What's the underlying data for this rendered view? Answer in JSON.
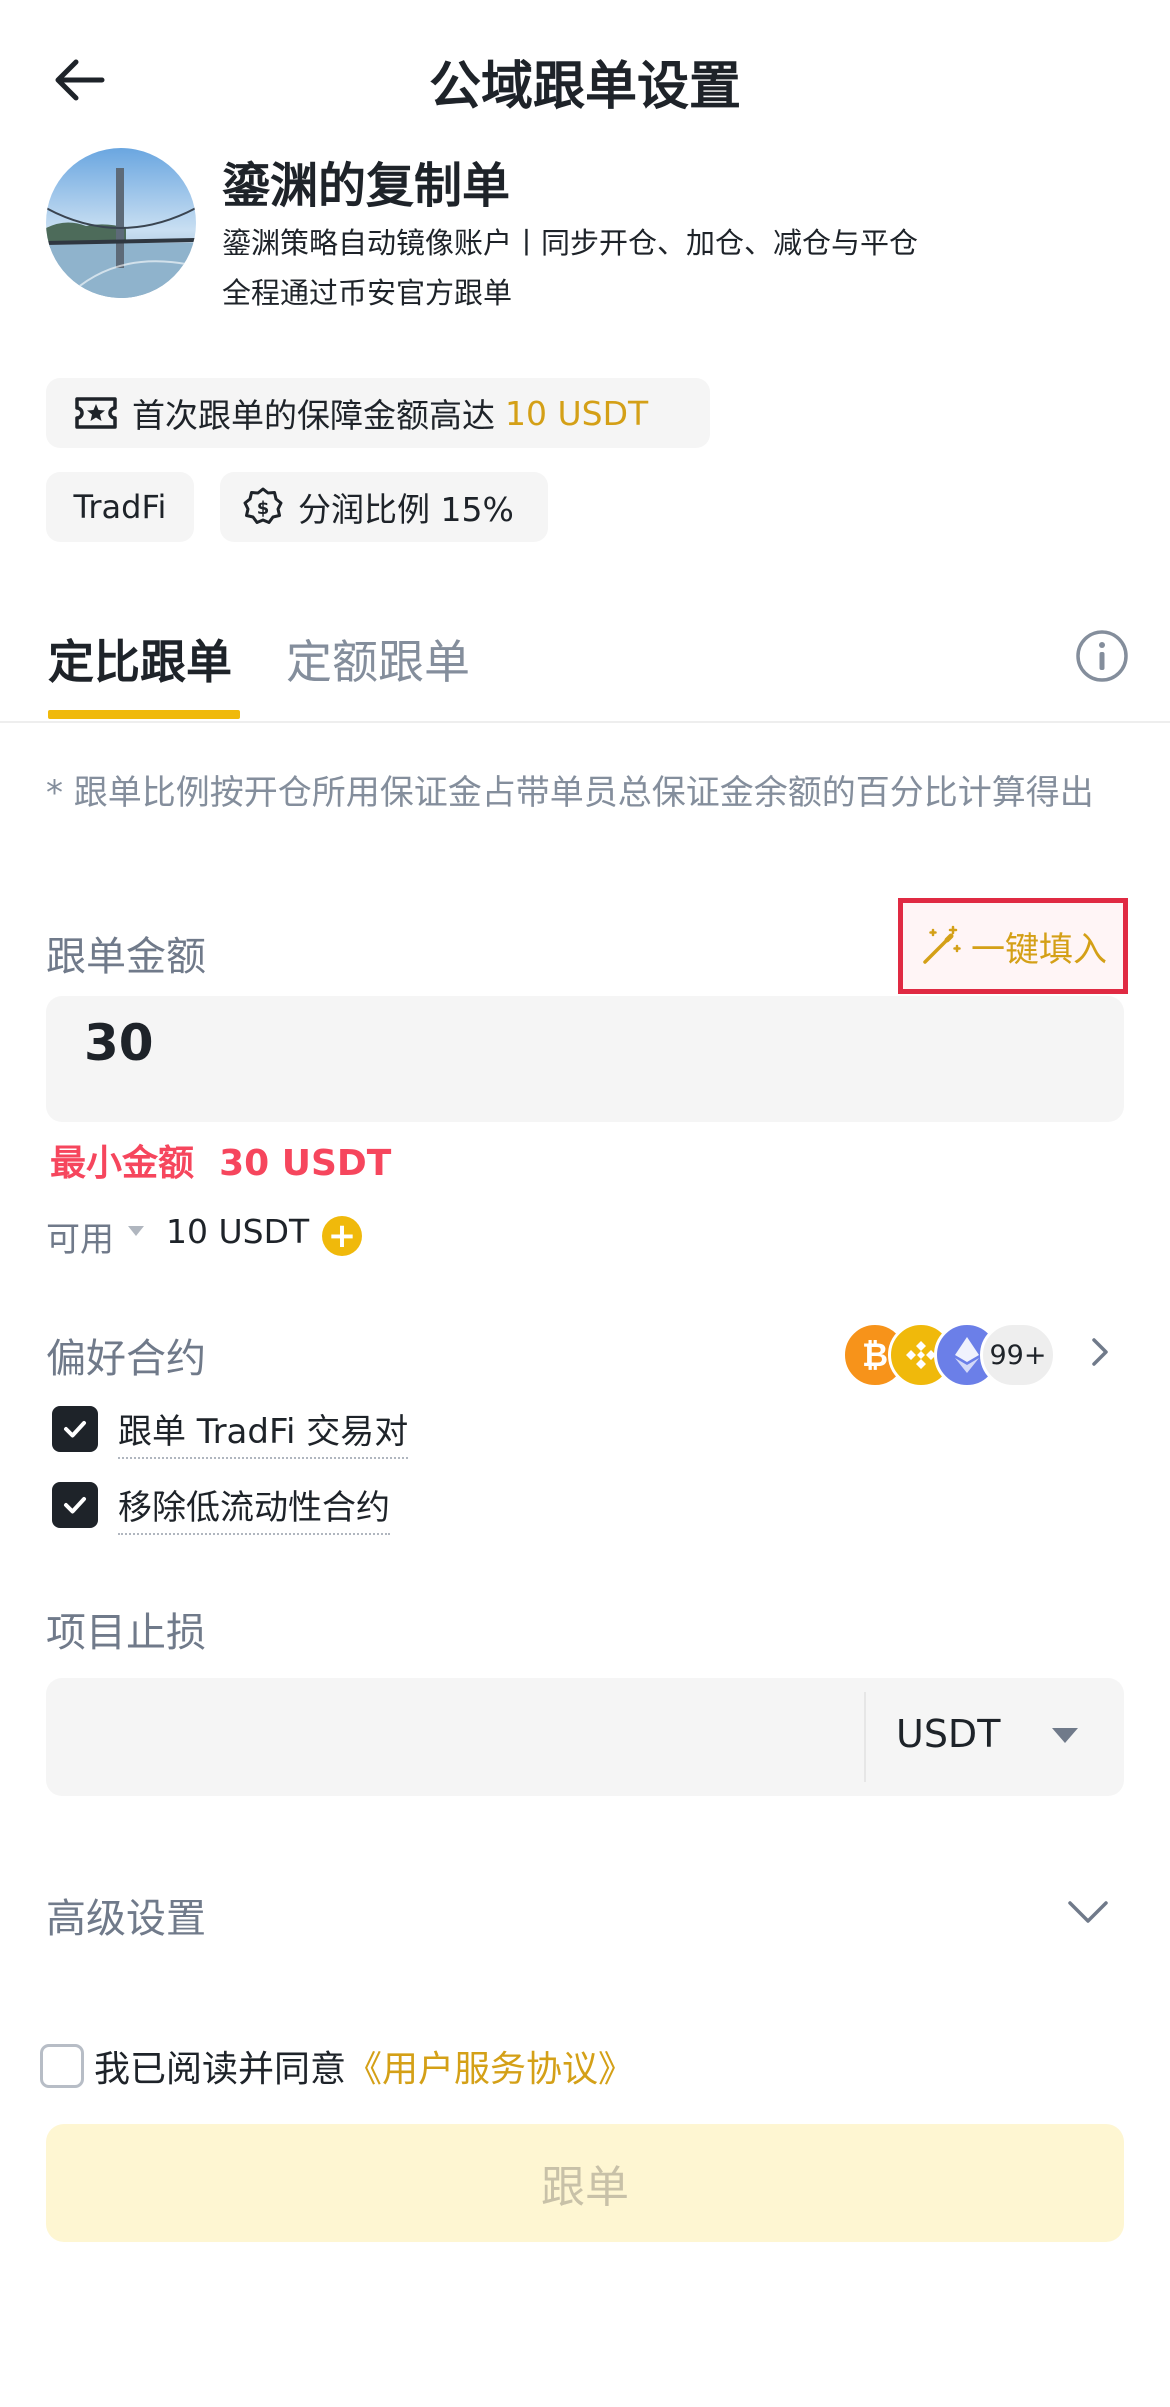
{
  "header": {
    "title": "公域跟单设置"
  },
  "profile": {
    "name": "鎏渊的复制单",
    "description_line1": "鎏渊策略自动镜像账户丨同步开仓、加仓、减仓与平仓",
    "description_line2": "全程通过币安官方跟单"
  },
  "tags": {
    "guarantee_text": "首次跟单的保障金额高达",
    "guarantee_amount": "10 USDT",
    "tradfi": "TradFi",
    "profit_share": "分润比例 15%"
  },
  "tabs": [
    {
      "label": "定比跟单",
      "active": true
    },
    {
      "label": "定额跟单",
      "active": false
    }
  ],
  "note": "* 跟单比例按开仓所用保证金占带单员总保证金余额的百分比计算得出",
  "amount": {
    "label": "跟单金额",
    "autofill_label": "一键填入",
    "value": "30",
    "min_label": "最小金额",
    "min_value": "30 USDT",
    "available_label": "可用",
    "available_value": "10 USDT",
    "plus": "+"
  },
  "preferred_contracts": {
    "label": "偏好合约",
    "coins": [
      "btc-icon",
      "bnb-icon",
      "eth-icon"
    ],
    "more_count": "99+",
    "options": [
      {
        "label": "跟单 TradFi 交易对",
        "checked": true
      },
      {
        "label": "移除低流动性合约",
        "checked": true
      }
    ]
  },
  "stop_loss": {
    "label": "项目止损",
    "value": "",
    "unit": "USDT"
  },
  "advanced": {
    "label": "高级设置"
  },
  "agreement": {
    "text": "我已阅读并同意",
    "link": "《用户服务协议》",
    "checked": false
  },
  "submit_label": "跟单",
  "colors": {
    "accent": "#f0b90b",
    "accent_text": "#d4a017",
    "error": "#f6465d",
    "highlight_border": "#e02a43"
  }
}
